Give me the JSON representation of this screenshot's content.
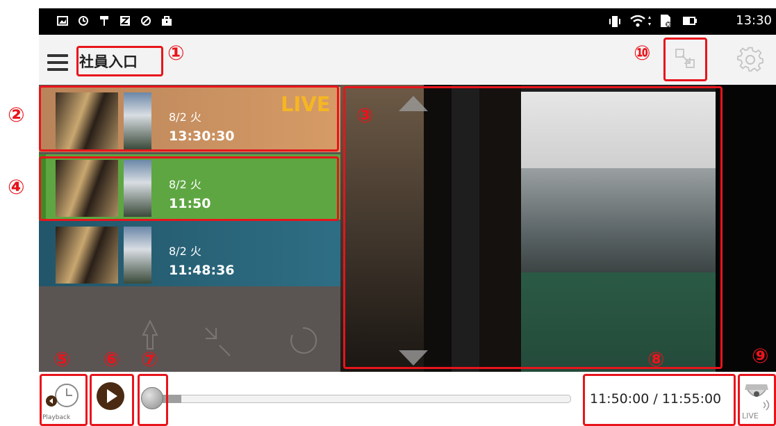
{
  "status_bar": {
    "time": "13:30",
    "icons": [
      "image-icon",
      "sync-icon",
      "hammer-icon",
      "z-icon",
      "blocked-icon",
      "briefcase-icon",
      "vibrate-icon",
      "wifi-icon",
      "sd-card-icon",
      "battery-icon"
    ]
  },
  "app_bar": {
    "title": "社員入口",
    "menu_icon": "hamburger-menu-icon",
    "fullscreen_icon": "expand-arrows-icon",
    "settings_icon": "gear-icon"
  },
  "recordings": [
    {
      "date": "8/2 火",
      "time": "13:30:30",
      "badge": "LIVE",
      "color": "#c98a5a"
    },
    {
      "date": "8/2 火",
      "time": "11:50",
      "color": "#56a03a"
    },
    {
      "date": "8/2 火",
      "time": "11:48:36",
      "color": "#2a5f72"
    }
  ],
  "controls": {
    "playback_label": "Playback",
    "live_label": "LIVE",
    "timecode": "11:50:00 / 11:55:00",
    "progress_fraction": 0.09
  },
  "annotations": [
    "①",
    "②",
    "③",
    "④",
    "⑤",
    "⑥",
    "⑦",
    "⑧",
    "⑨",
    "⑩"
  ],
  "colors": {
    "annotation": "#e8141c",
    "live_badge": "#f5b623",
    "play_button": "#4a2a12"
  }
}
